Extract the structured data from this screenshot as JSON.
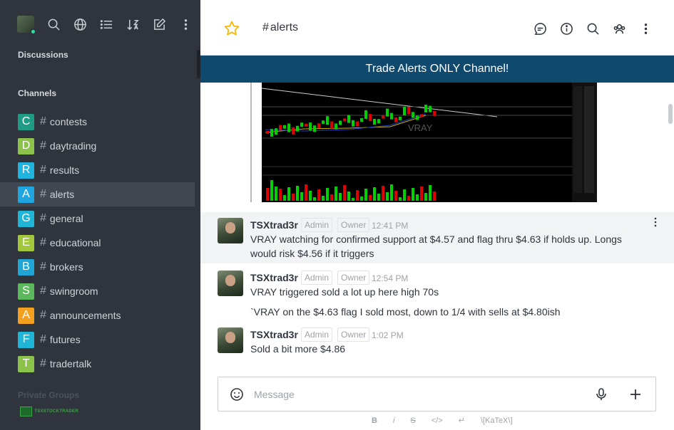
{
  "sidebar": {
    "discussions_label": "Discussions",
    "channels_label": "Channels",
    "bottom_label": "Private Groups",
    "brand_text": "TSXSTOCKTRADER",
    "channels": [
      {
        "letter": "C",
        "name": "contests",
        "color": "#1e9c86",
        "active": false
      },
      {
        "letter": "D",
        "name": "daytrading",
        "color": "#8bc34a",
        "active": false
      },
      {
        "letter": "R",
        "name": "results",
        "color": "#1fb5e0",
        "active": false
      },
      {
        "letter": "A",
        "name": "alerts",
        "color": "#1fa6e0",
        "active": true
      },
      {
        "letter": "G",
        "name": "general",
        "color": "#1fb5d6",
        "active": false
      },
      {
        "letter": "E",
        "name": "educational",
        "color": "#a3c73a",
        "active": false
      },
      {
        "letter": "B",
        "name": "brokers",
        "color": "#1fa6d6",
        "active": false
      },
      {
        "letter": "S",
        "name": "swingroom",
        "color": "#5cb85c",
        "active": false
      },
      {
        "letter": "A",
        "name": "announcements",
        "color": "#f2a01e",
        "active": false
      },
      {
        "letter": "F",
        "name": "futures",
        "color": "#1fb5d6",
        "active": false
      },
      {
        "letter": "T",
        "name": "tradertalk",
        "color": "#8bc34a",
        "active": false
      }
    ]
  },
  "header": {
    "room_name": "alerts",
    "hash": "#"
  },
  "announcement": "Trade Alerts ONLY Channel!",
  "chart_image": {
    "ticker": "VRAY"
  },
  "messages": [
    {
      "user": "TSXtrad3r",
      "role1": "Admin",
      "role2": "Owner",
      "time": "12:41 PM",
      "lines": [
        "VRAY watching for confirmed support at $4.57 and flag thru $4.63 if holds up. Longs",
        "would risk $4.56 if it triggers"
      ]
    },
    {
      "user": "TSXtrad3r",
      "role1": "Admin",
      "role2": "Owner",
      "time": "12:54 PM",
      "lines": [
        "VRAY triggered sold a lot up here high 70s"
      ],
      "followup": "`VRAY on the $4.63 flag I sold most, down to 1/4 with sells at $4.80ish"
    },
    {
      "user": "TSXtrad3r",
      "role1": "Admin",
      "role2": "Owner",
      "time": "1:02 PM",
      "lines": [
        "Sold a bit more $4.86"
      ]
    }
  ],
  "composer": {
    "placeholder": "Message"
  },
  "format_bar": {
    "bold": "B",
    "italic": "i",
    "strike": "S",
    "code": "</>",
    "enter": "↵",
    "katex": "\\[KaTeX\\]"
  }
}
